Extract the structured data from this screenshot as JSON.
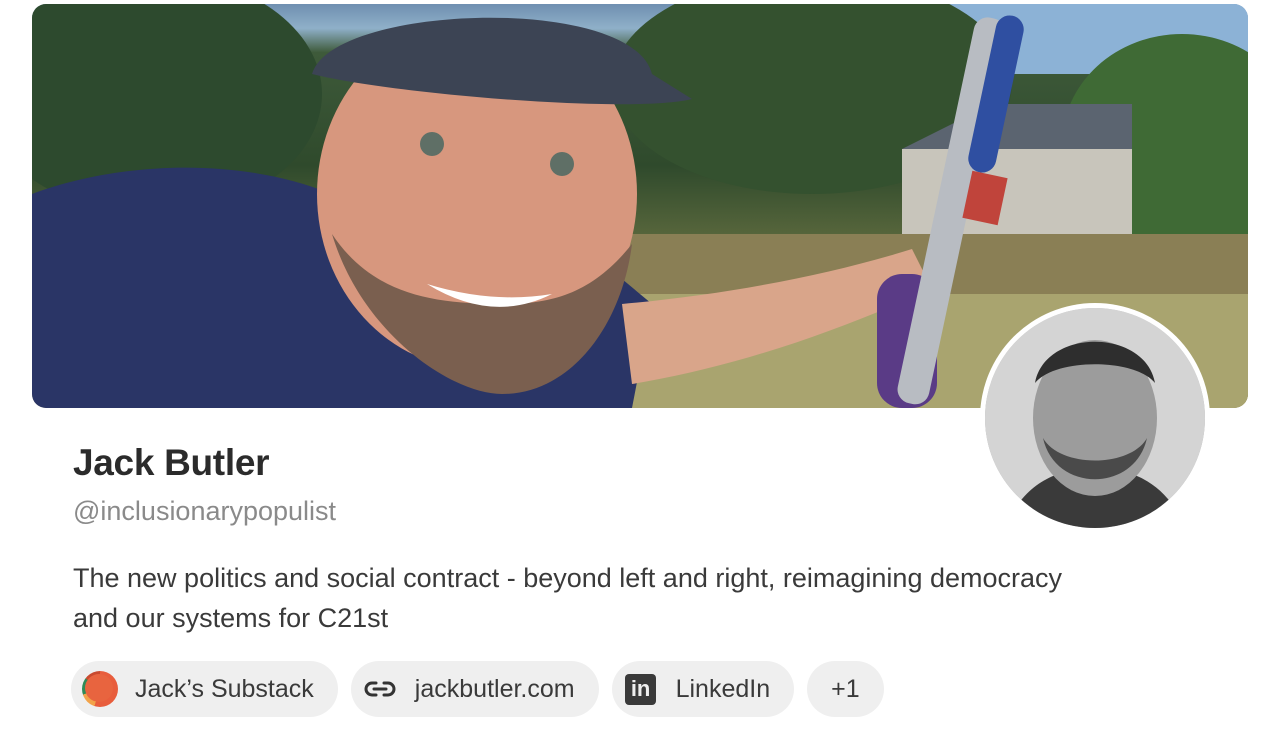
{
  "profile": {
    "name": "Jack Butler",
    "handle": "@inclusionarypopulist",
    "bio": "The new politics and social contract - beyond left and right, reimagining democracy and our systems for C21st"
  },
  "links": [
    {
      "label": "Jack’s Substack",
      "icon": "substack-logo-icon"
    },
    {
      "label": "jackbutler.com",
      "icon": "link-icon"
    },
    {
      "label": "LinkedIn",
      "icon": "linkedin-icon"
    },
    {
      "label": "+1",
      "icon": ""
    }
  ],
  "colors": {
    "chip_background": "#efefef",
    "handle_text": "#8a8a8a",
    "name_text": "#2b2b2b"
  }
}
